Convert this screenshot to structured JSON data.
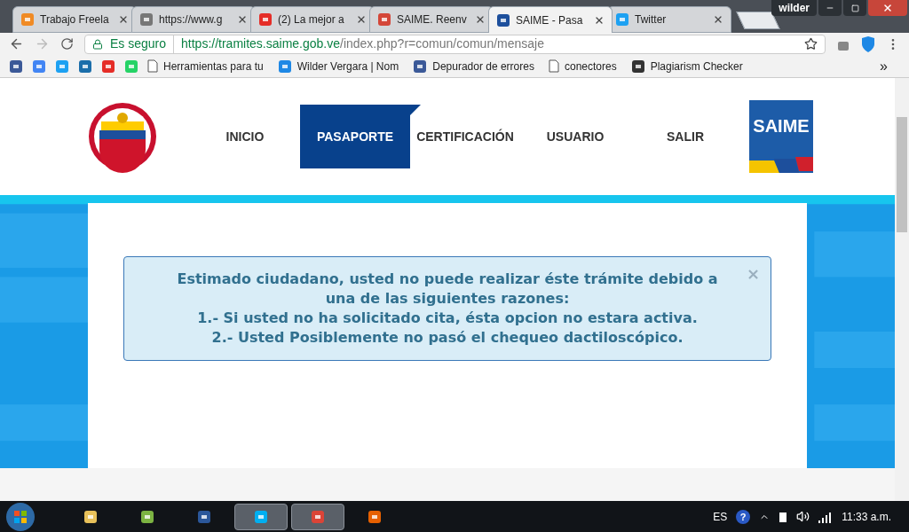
{
  "tabs": [
    {
      "title": "Trabajo Freela",
      "selected": false
    },
    {
      "title": "https://www.g",
      "selected": false
    },
    {
      "title": "(2) La mejor a",
      "selected": false
    },
    {
      "title": "SAIME. Reenv",
      "selected": false
    },
    {
      "title": "SAIME - Pasa",
      "selected": true
    },
    {
      "title": "Twitter",
      "selected": false
    }
  ],
  "profile": "wilder",
  "address": {
    "security": "Es seguro",
    "host": "https://tramites.saime.gob.ve",
    "path": "/index.php?r=comun/comun/mensaje"
  },
  "bookmarks": [
    {
      "label": "Herramientas para tu"
    },
    {
      "label": "Wilder Vergara | Nom"
    },
    {
      "label": "Depurador de errores"
    },
    {
      "label": "conectores"
    },
    {
      "label": "Plagiarism Checker"
    }
  ],
  "more_bookmarks": "»",
  "nav": [
    {
      "label": "INICIO",
      "selected": false
    },
    {
      "label": "PASAPORTE",
      "selected": true
    },
    {
      "label": "CERTIFICACIÓN",
      "selected": false
    },
    {
      "label": "USUARIO",
      "selected": false
    },
    {
      "label": "SALIR",
      "selected": false
    }
  ],
  "brand": "SAIME",
  "alert": {
    "lines": [
      "Estimado ciudadano, usted no puede realizar éste trámite debido a una de las siguientes razones:",
      "1.- Si usted no ha solicitado cita, ésta opcion no estara activa.",
      "2.- Usted Posiblemente no pasó el chequeo dactiloscópico."
    ],
    "close": "×"
  },
  "taskbar": {
    "apps": [
      {
        "selected": false
      },
      {
        "selected": false
      },
      {
        "selected": false
      },
      {
        "selected": true
      },
      {
        "selected": true
      },
      {
        "selected": false
      }
    ],
    "language": "ES",
    "help": "?",
    "time": "11:33 a.m."
  }
}
